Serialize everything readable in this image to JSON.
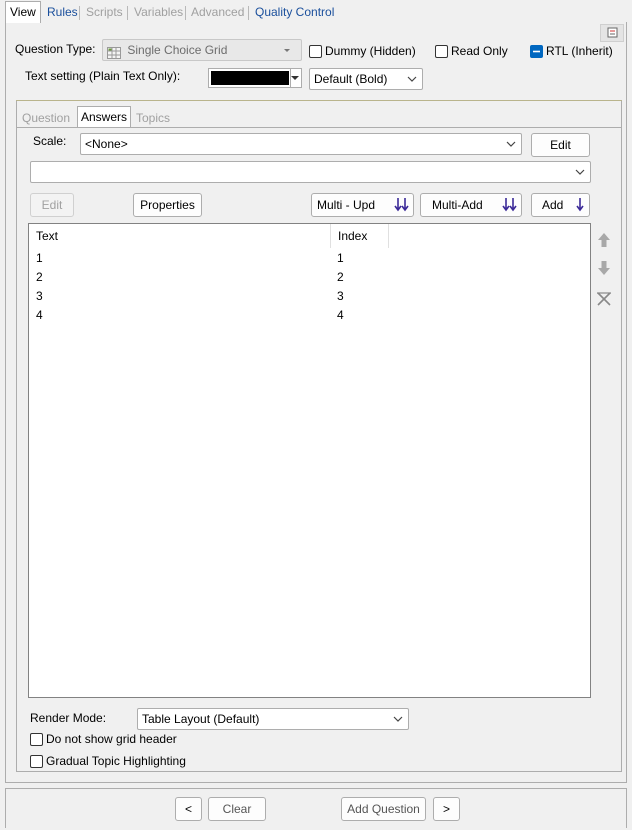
{
  "top_tabs": [
    {
      "label": "View",
      "state": "active"
    },
    {
      "label": "Rules",
      "state": "link"
    },
    {
      "label": "Scripts",
      "state": "disabled"
    },
    {
      "label": "Variables",
      "state": "disabled"
    },
    {
      "label": "Advanced",
      "state": "disabled"
    },
    {
      "label": "Quality Control",
      "state": "link"
    }
  ],
  "question_type": {
    "label": "Question Type:",
    "value": "Single Choice Grid"
  },
  "checkboxes": {
    "dummy": {
      "label": "Dummy (Hidden)",
      "checked": false
    },
    "read_only": {
      "label": "Read Only",
      "checked": false
    },
    "rtl": {
      "label": "RTL (Inherit)",
      "checked": true
    }
  },
  "text_setting": {
    "label": "Text setting (Plain Text Only):",
    "color": "#000000",
    "font_value": "Default (Bold)"
  },
  "inner_tabs": [
    "Question",
    "Answers",
    "Topics"
  ],
  "scale": {
    "label": "Scale:",
    "value": "<None>",
    "edit_label": "Edit"
  },
  "second_combo": {
    "value": ""
  },
  "buttons": {
    "edit": "Edit",
    "properties": "Properties",
    "multi_upd": "Multi - Upd",
    "multi_add": "Multi-Add",
    "add": "Add"
  },
  "grid": {
    "columns": [
      "Text",
      "Index"
    ],
    "rows": [
      {
        "text": "1",
        "index": "1"
      },
      {
        "text": "2",
        "index": "2"
      },
      {
        "text": "3",
        "index": "3"
      },
      {
        "text": "4",
        "index": "4"
      }
    ]
  },
  "render_mode": {
    "label": "Render Mode:",
    "value": "Table Layout (Default)"
  },
  "options": {
    "no_grid_header": {
      "label": "Do not show grid header",
      "checked": false
    },
    "gradual_topic": {
      "label": "Gradual Topic Highlighting",
      "checked": false
    }
  },
  "bottom_buttons": {
    "prev": "<",
    "clear": "Clear",
    "add_question": "Add Question",
    "next": ">"
  },
  "colors": {
    "accent": "#0067c0",
    "link": "#1a4f9c",
    "arrow_purple": "#3c2a98"
  }
}
